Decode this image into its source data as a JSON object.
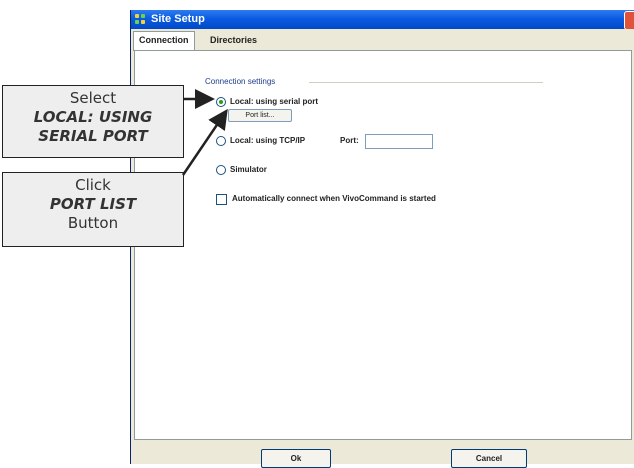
{
  "window": {
    "title": "Site Setup",
    "tabs": [
      {
        "label": "Connection",
        "active": true
      },
      {
        "label": "Directories",
        "active": false
      }
    ]
  },
  "connection_settings": {
    "group_label": "Connection settings",
    "options": [
      {
        "label": "Local: using serial port",
        "selected": true
      },
      {
        "label": "Local: using TCP/IP",
        "selected": false
      },
      {
        "label": "Simulator",
        "selected": false
      }
    ],
    "port_list_button": "Port list...",
    "port_label": "Port:",
    "port_value": "",
    "auto_connect_label": "Automatically connect when VivoCommand is started",
    "auto_connect_checked": false
  },
  "footer": {
    "ok_label": "Ok",
    "cancel_label": "Cancel"
  },
  "callouts": [
    {
      "lines": [
        "Select",
        "LOCAL: USING",
        "SERIAL PORT"
      ]
    },
    {
      "lines": [
        "Click",
        "PORT LIST",
        "Button"
      ]
    }
  ],
  "colors": {
    "titlebar": "#0a5ce0",
    "window_bg": "#ece9d8",
    "callout_bg": "#eeeeee",
    "radio_dot": "#21a121"
  }
}
